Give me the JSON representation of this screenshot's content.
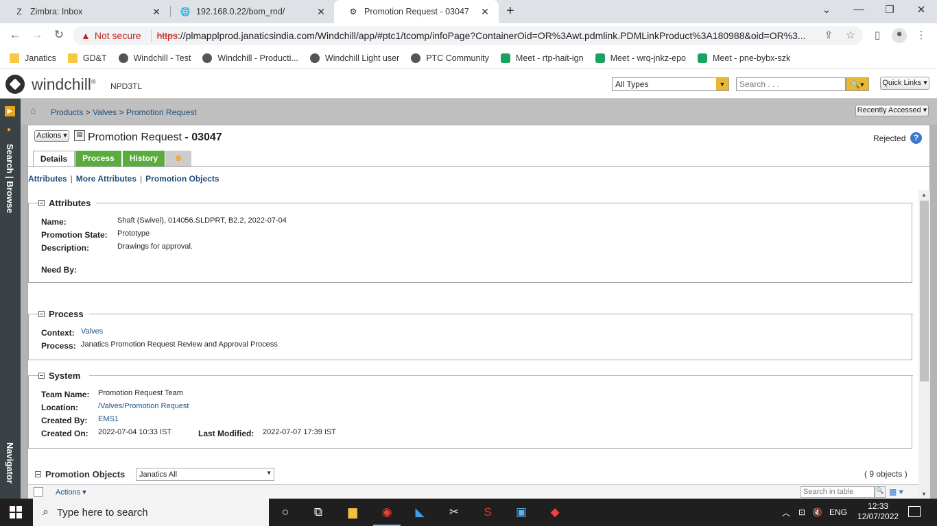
{
  "browser": {
    "tabs": [
      {
        "title": "Zimbra: Inbox",
        "icon": "zimbra-icon"
      },
      {
        "title": "192.168.0.22/bom_rnd/",
        "icon": "globe-icon"
      },
      {
        "title": "Promotion Request - 03047",
        "icon": "windchill-icon",
        "active": true
      }
    ],
    "security_label": "Not secure",
    "url_scheme": "https",
    "url_rest": "://plmapplprod.janaticsindia.com/Windchill/app/#ptc1/tcomp/infoPage?ContainerOid=OR%3Awt.pdmlink.PDMLinkProduct%3A180988&oid=OR%3...",
    "bookmarks": [
      {
        "label": "Janatics",
        "icon": "folder"
      },
      {
        "label": "GD&T",
        "icon": "folder"
      },
      {
        "label": "Windchill - Test",
        "icon": "gear"
      },
      {
        "label": "Windchill - Producti...",
        "icon": "gear"
      },
      {
        "label": "Windchill Light user",
        "icon": "gear"
      },
      {
        "label": "PTC Community",
        "icon": "gear"
      },
      {
        "label": "Meet - rtp-hait-ign",
        "icon": "meet"
      },
      {
        "label": "Meet - wrq-jnkz-epo",
        "icon": "meet"
      },
      {
        "label": "Meet - pne-bybx-szk",
        "icon": "meet"
      }
    ]
  },
  "header": {
    "logo_text": "windchill",
    "logo_mark": "®",
    "server": "NPD3TL",
    "type_select": "All Types",
    "search_placeholder": "Search . . .",
    "quick_links": "Quick Links"
  },
  "leftnav": {
    "search_browse": "Search | Browse",
    "navigator": "Navigator"
  },
  "breadcrumb": {
    "items": [
      "Products",
      "Valves",
      "Promotion Request"
    ],
    "recently_accessed": "Recently Accessed"
  },
  "page": {
    "actions": "Actions",
    "title_prefix": "Promotion Request",
    "title_number": " - 03047",
    "status": "Rejected",
    "tabs": [
      "Details",
      "Process",
      "History"
    ],
    "sublinks": [
      "Attributes",
      "More Attributes",
      "Promotion Objects"
    ]
  },
  "attributes": {
    "heading": "Attributes",
    "name_label": "Name:",
    "name_value": "Shaft (Swivel), 014056.SLDPRT, B2.2, 2022-07-04",
    "state_label": "Promotion State:",
    "state_value": "Prototype",
    "desc_label": "Description:",
    "desc_value": "Drawings for approval.",
    "needby_label": "Need By:"
  },
  "process": {
    "heading": "Process",
    "context_label": "Context:",
    "context_value": "Valves",
    "process_label": "Process:",
    "process_value": "Janatics Promotion Request Review and Approval Process"
  },
  "system": {
    "heading": "System",
    "team_label": "Team Name:",
    "team_value": "Promotion Request Team",
    "location_label": "Location:",
    "location_value": "/Valves/Promotion Request",
    "createdby_label": "Created By:",
    "createdby_value": "EMS1",
    "createdon_label": "Created On:",
    "createdon_value": "2022-07-04 10:33 IST",
    "modified_label": "Last Modified:",
    "modified_value": "2022-07-07 17:39 IST"
  },
  "promotion_objects": {
    "heading": "Promotion Objects",
    "view": "Janatics All",
    "count": "( 9 objects )",
    "actions": "Actions",
    "search_placeholder": "Search in table"
  },
  "taskbar": {
    "search_placeholder": "Type here to search",
    "lang": "ENG",
    "time": "12:33",
    "date": "12/07/2022"
  }
}
